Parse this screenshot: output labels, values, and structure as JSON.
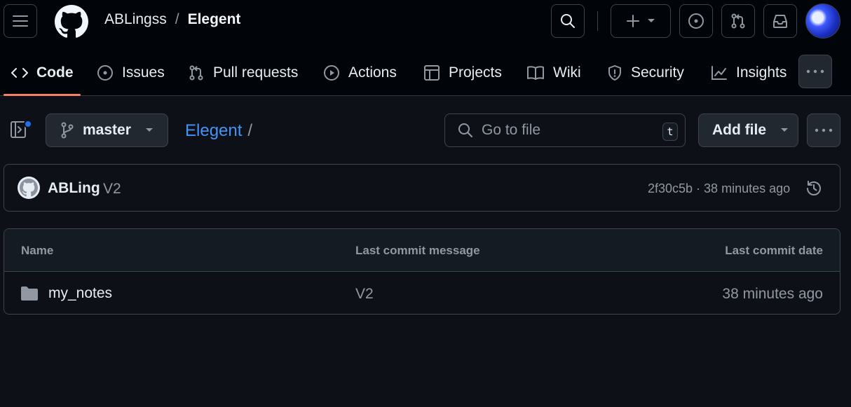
{
  "header": {
    "owner": "ABLingss",
    "separator": "/",
    "repo": "Elegent"
  },
  "icons": {
    "menu": "hamburger-icon",
    "logo": "github-mark-icon",
    "search": "search-icon",
    "create": "plus-icon",
    "issues": "issue-opened-icon",
    "pulls": "git-pull-request-icon",
    "inbox": "inbox-icon"
  },
  "nav": {
    "tabs": [
      {
        "label": "Code",
        "icon": "code-icon",
        "selected": true
      },
      {
        "label": "Issues",
        "icon": "issue-opened-icon"
      },
      {
        "label": "Pull requests",
        "icon": "git-pull-request-icon"
      },
      {
        "label": "Actions",
        "icon": "play-icon"
      },
      {
        "label": "Projects",
        "icon": "table-icon"
      },
      {
        "label": "Wiki",
        "icon": "book-icon"
      },
      {
        "label": "Security",
        "icon": "shield-icon"
      },
      {
        "label": "Insights",
        "icon": "graph-icon"
      }
    ]
  },
  "toolbar": {
    "branch": "master",
    "path_repo": "Elegent",
    "path_slash": "/",
    "goto_placeholder": "Go to file",
    "goto_shortcut": "t",
    "add_file_label": "Add file"
  },
  "latest_commit": {
    "author": "ABLing",
    "message": "V2",
    "meta": "2f30c5b · 38 minutes ago"
  },
  "file_table": {
    "columns": [
      "Name",
      "Last commit message",
      "Last commit date"
    ],
    "rows": [
      {
        "name": "my_notes",
        "type": "folder",
        "message": "V2",
        "date": "38 minutes ago"
      }
    ]
  },
  "colors": {
    "background": "#0d1117",
    "header_background": "#010409",
    "link": "#4493f8",
    "selected_tab_underline": "#f78166",
    "notification_dot": "#1f6feb"
  }
}
